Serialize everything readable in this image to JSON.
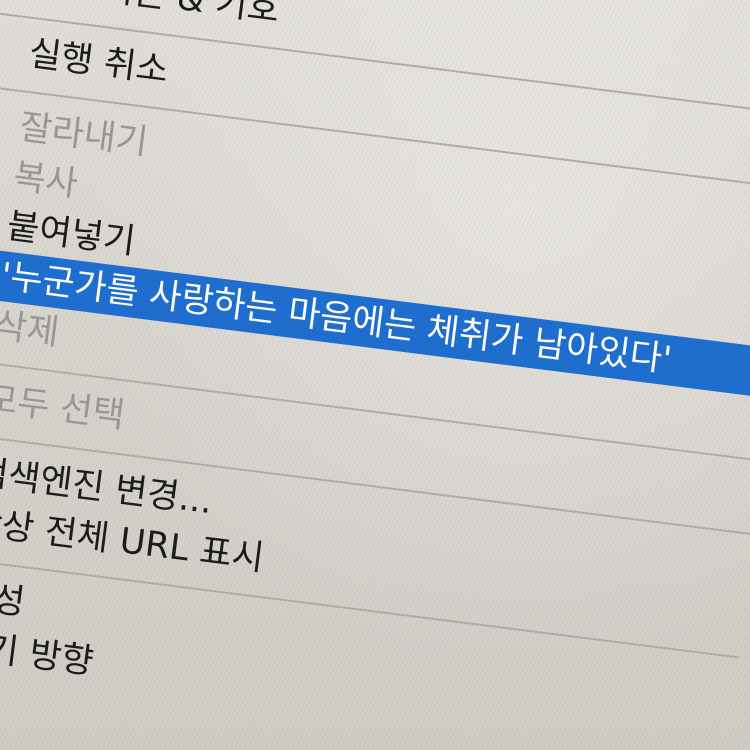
{
  "menu": {
    "emoji_symbols": "이모티콘 & 기호",
    "undo": "실행 취소",
    "cut": "잘라내기",
    "copy": "복사",
    "paste": "붙여넣기",
    "search_selection": "'누군가를 사랑하는 마음에는 체취가 남아있다'",
    "delete": "삭제",
    "select_all": "모두 선택",
    "change_search_engine": "검색엔진 변경...",
    "show_full_url": "항상 전체 URL 표시",
    "speech": "음성",
    "writing_direction": "쓰기 방향"
  },
  "colors": {
    "selection": "#1f6fd1",
    "disabled_text": "#9d9893",
    "text": "#1c1c1c"
  }
}
